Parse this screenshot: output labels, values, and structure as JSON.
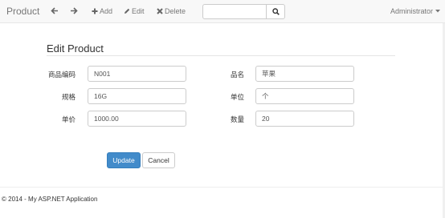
{
  "navbar": {
    "brand": "Product",
    "add_label": "Add",
    "edit_label": "Edit",
    "delete_label": "Delete",
    "search_value": "",
    "user_label": "Administrator"
  },
  "form": {
    "title": "Edit Product",
    "fields": [
      {
        "label": "商品编码",
        "value": "N001"
      },
      {
        "label": "品名",
        "value": "苹果"
      },
      {
        "label": "规格",
        "value": "16G"
      },
      {
        "label": "单位",
        "value": "个"
      },
      {
        "label": "单价",
        "value": "1000.00"
      },
      {
        "label": "数量",
        "value": "20"
      }
    ],
    "update_label": "Update",
    "cancel_label": "Cancel"
  },
  "footer": {
    "text": "© 2014 - My ASP.NET Application"
  }
}
